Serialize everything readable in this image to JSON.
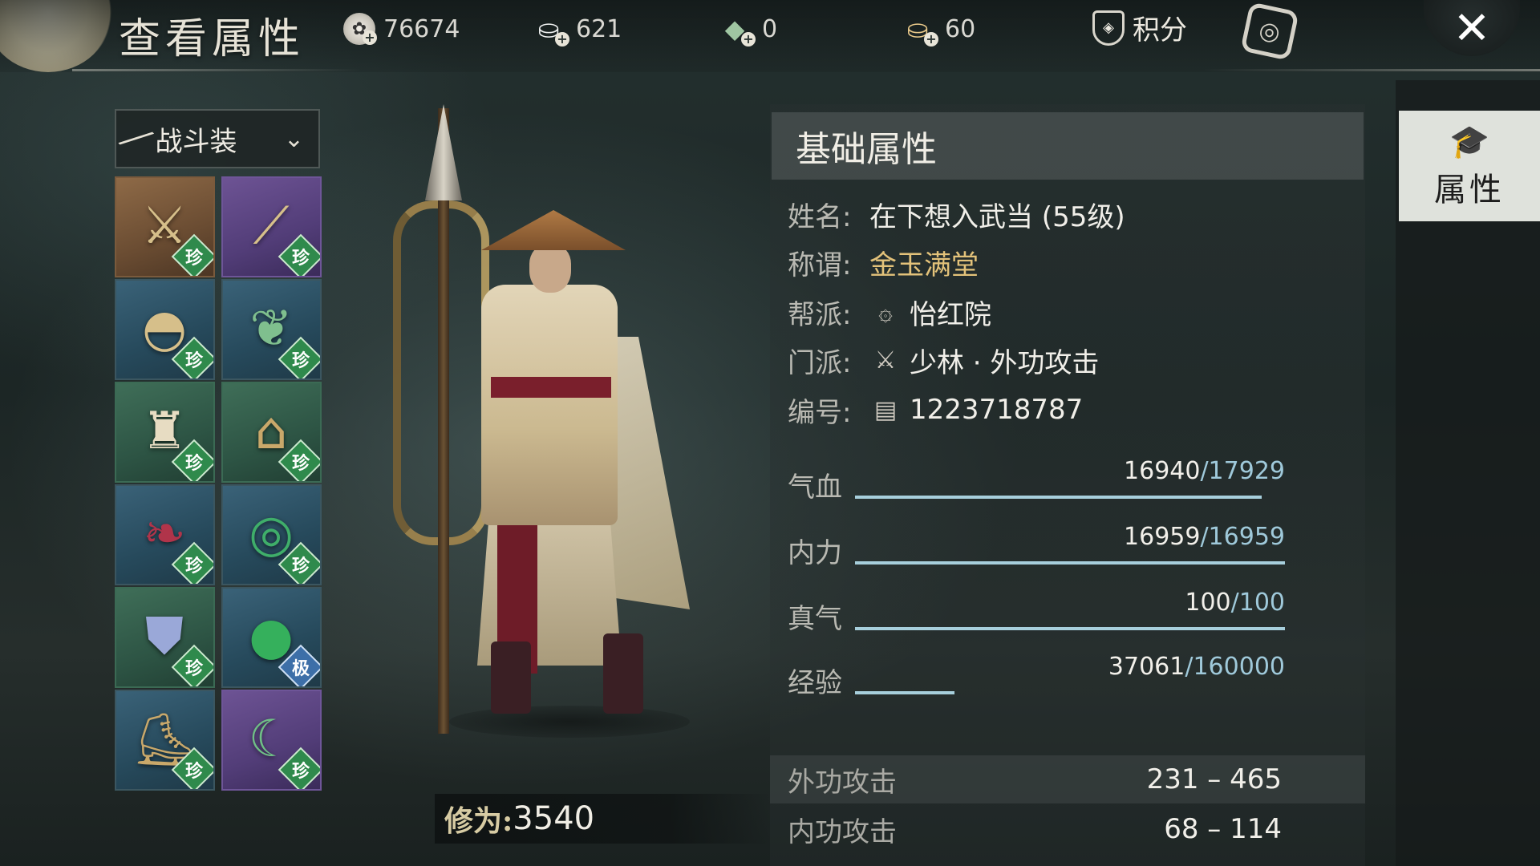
{
  "header": {
    "title": "查看属性",
    "resources": [
      {
        "icon": "coin-icon",
        "value": "76674"
      },
      {
        "icon": "silver-ingot-icon",
        "value": "621"
      },
      {
        "icon": "jade-ticket-icon",
        "value": "0"
      },
      {
        "icon": "gold-ingot-icon",
        "value": "60"
      }
    ],
    "score_label": "积分",
    "close_glyph": "✕"
  },
  "outfit": {
    "selected": "战斗装"
  },
  "equipment": [
    {
      "name": "weapon",
      "icon": "spear-icon",
      "badge": "珍"
    },
    {
      "name": "hidden-weapon",
      "icon": "dagger-icon",
      "badge": "珍"
    },
    {
      "name": "headwear",
      "icon": "hat-icon",
      "badge": "珍"
    },
    {
      "name": "necklace",
      "icon": "jade-pendant-icon",
      "badge": "珍"
    },
    {
      "name": "armor",
      "icon": "robe-icon",
      "badge": "珍"
    },
    {
      "name": "bracer",
      "icon": "bracer-icon",
      "badge": "珍"
    },
    {
      "name": "belt",
      "icon": "belt-icon",
      "badge": "珍"
    },
    {
      "name": "bracelet",
      "icon": "bangle-icon",
      "badge": "珍"
    },
    {
      "name": "pants",
      "icon": "skirt-icon",
      "badge": "珍"
    },
    {
      "name": "ring",
      "icon": "jade-ring-icon",
      "badge": "极"
    },
    {
      "name": "boots",
      "icon": "boots-icon",
      "badge": "珍"
    },
    {
      "name": "accessory",
      "icon": "crescent-jade-icon",
      "badge": "珍"
    }
  ],
  "cultivation": {
    "label": "修为:",
    "value": "3540"
  },
  "attributes": {
    "title": "基础属性",
    "name_label": "姓名:",
    "name_value": "在下想入武当 (55级)",
    "title_label": "称谓:",
    "title_value": "金玉满堂",
    "guild_label": "帮派:",
    "guild_value": "怡红院",
    "sect_label": "门派:",
    "sect_value": "少林 · 外功攻击",
    "id_label": "编号:",
    "id_value": "1223718787",
    "stats": [
      {
        "label": "气血",
        "current": "16940",
        "max": "/17929",
        "ratio": 0.945
      },
      {
        "label": "内力",
        "current": "16959",
        "max": "/16959",
        "ratio": 1.0
      },
      {
        "label": "真气",
        "current": "100",
        "max": "/100",
        "ratio": 1.0
      },
      {
        "label": "经验",
        "current": "37061",
        "max": "/160000",
        "ratio": 0.232
      }
    ],
    "attacks": [
      {
        "label": "外功攻击",
        "value": "231 – 465"
      },
      {
        "label": "内功攻击",
        "value": "68 – 114"
      }
    ]
  },
  "side_tab": {
    "label": "属性",
    "icon": "scholar-hat-icon"
  },
  "colors": {
    "stat_bar": "#a7cfdc",
    "title_gold": "#e3c27a",
    "badge_green": "#2f8a4c",
    "badge_blue": "#3d6fa8"
  }
}
